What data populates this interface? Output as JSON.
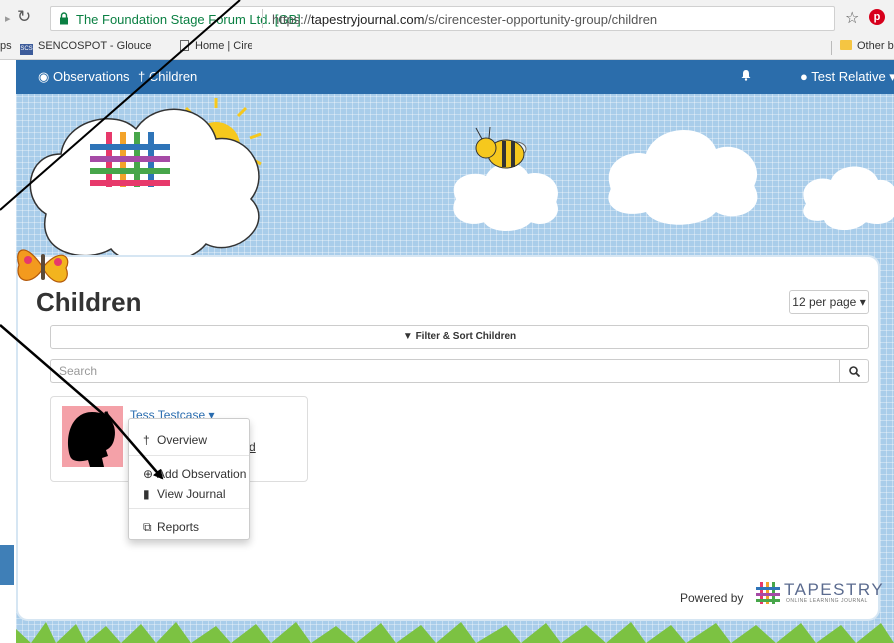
{
  "browser": {
    "site_name": "The Foundation Stage Forum Ltd. [GB]",
    "url_scheme": "https://",
    "url_host": "tapestryjournal.com",
    "url_path": "/s/cirencester-opportunity-group/children",
    "bookmarks": {
      "apps": "ps",
      "sencospot": "SENCOSPOT - Glouce",
      "home": "Home | Cirencester C",
      "other": "Other bo"
    }
  },
  "navbar": {
    "observations": "Observations",
    "children": "Children",
    "user": "Test Relative"
  },
  "main": {
    "title": "Children",
    "per_page": "12 per page",
    "filter_label": "Filter & Sort Children",
    "search_placeholder": "Search"
  },
  "child": {
    "name": "Tess Testcase",
    "partial_link": "eriod"
  },
  "child_menu": {
    "overview": "Overview",
    "add_observation": "Add Observation",
    "view_journal": "View Journal",
    "reports": "Reports"
  },
  "footer": {
    "powered_by": "Powered by",
    "logo_word": "TAPESTRY",
    "logo_subtitle": "ONLINE LEARNING JOURNAL"
  },
  "colors": {
    "navbar": "#2b6dab",
    "link": "#2a6db0",
    "sky": "#a9cdea",
    "avatar_bg": "#f4a1a8"
  }
}
